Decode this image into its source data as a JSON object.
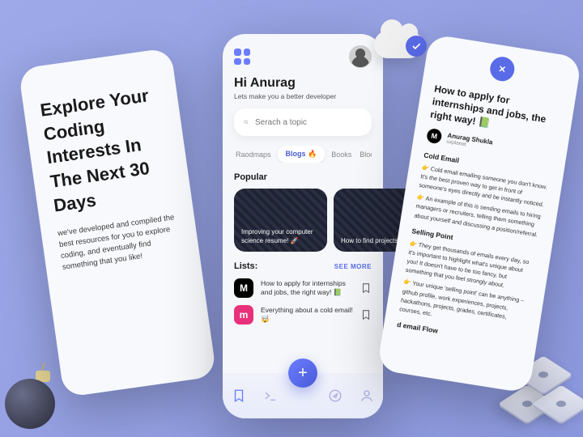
{
  "left": {
    "headline_pre": "Explore Your Coding Interests In The Next ",
    "headline_bold": "30 Days",
    "sub": "we've developed and compiled the best resources for you to explore coding, and eventually find something that you like!"
  },
  "mid": {
    "greeting": "Hi Anurag",
    "tagline": "Lets make you a better developer",
    "search_placeholder": "Serach a topic",
    "tabs": [
      {
        "label": "Raodmaps",
        "active": false
      },
      {
        "label": "Blogs 🔥",
        "active": true
      },
      {
        "label": "Books",
        "active": false
      },
      {
        "label": "Blockch",
        "active": false
      }
    ],
    "popular_title": "Popular",
    "cards": [
      {
        "text": "Improving your computer science resume! 🚀"
      },
      {
        "text": "How to find projects an"
      }
    ],
    "lists_title": "Lists:",
    "see_more": "SEE MORE",
    "lists": [
      {
        "icon": "M",
        "text": "How to apply for internships and jobs, the right way! 📗"
      },
      {
        "icon": "m",
        "text": "Everything about a cold email! 🤯"
      }
    ]
  },
  "right": {
    "title": "How to apply for internships and jobs, the right way! 📗",
    "author": "Anurag Shukla",
    "author_sub": "uxplanet",
    "body": {
      "h1": "Cold Email",
      "p1": "👉 Cold email emailing someone you don't know. It's the best proven way to get in front of someone's eyes directly and be instantly noticed.",
      "p2": "👉 An example of this is sending emails to hiring managers or recruiters, telling them something about yourself and discussing a position/referral.",
      "h2": "Selling Point",
      "p3": "👉 They get thousands of emails every day, so it's important to highlight what's unique about you! It doesn't have to be too fancy, but something that you feel strongly about.",
      "p4": "👉 Your unique 'selling point' can be anything – github profile, work experiences, projects, hackathons, projects, grades, certificates, courses, etc.",
      "h3": "d email Flow"
    }
  }
}
